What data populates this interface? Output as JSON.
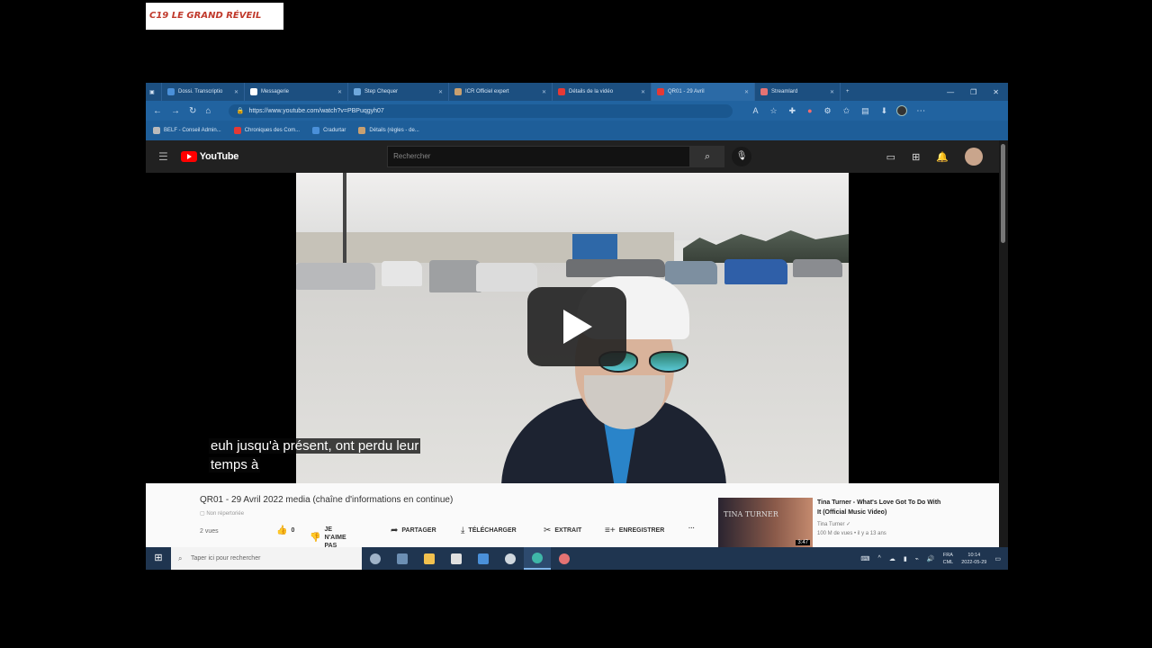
{
  "watermark": "C19 LE GRAND RÉVEIL",
  "browser": {
    "tabs": [
      {
        "label": "Dossi. Transcriptio",
        "color": "#4a90d9",
        "active": false
      },
      {
        "label": "Messagerie",
        "color": "#ffffff",
        "active": false
      },
      {
        "label": "Step Chequer",
        "color": "#6fa8dc",
        "active": false
      },
      {
        "label": "ICR Officiel expert",
        "color": "#c8a070",
        "active": false
      },
      {
        "label": "Détails de la vidéo",
        "color": "#e53935",
        "active": false
      },
      {
        "label": "QR01 - 29 Avril",
        "color": "#e53935",
        "active": true
      },
      {
        "label": "Streamlard",
        "color": "#e57373",
        "active": false
      }
    ],
    "window_controls": [
      "—",
      "❐",
      "✕"
    ],
    "url": "https://www.youtube.com/watch?v=PBPuqgyh07",
    "bookmarks": [
      {
        "label": "BELF - Conseil Admin...",
        "color": "#bbbbbb"
      },
      {
        "label": "Chroniques des Com...",
        "color": "#e53935"
      },
      {
        "label": "Cradurtar",
        "color": "#4a90d9"
      },
      {
        "label": "Détails (règles - de...",
        "color": "#c8a070"
      }
    ]
  },
  "youtube": {
    "logo_text": "YouTube",
    "search_placeholder": "Rechercher",
    "video": {
      "subtitle_line1": "euh jusqu'à présent, ont perdu leur",
      "subtitle_line2": "temps à",
      "title": "QR01 - 29 Avril 2022 media (chaîne d'informations en continue)",
      "channel_badge": "Non répertoriée",
      "views": "2 vues",
      "like_count": "0",
      "dislike_label": "JE N'AIME PAS",
      "share_label": "PARTAGER",
      "download_label": "TÉLÉCHARGER",
      "clip_label": "EXTRAIT",
      "save_label": "ENREGISTRER",
      "more_label": "···"
    },
    "recommendation": {
      "title": "Tina Turner - What's Love Got To Do With It (Official Music Video)",
      "channel": "Tina Turner ✓",
      "meta": "100 M de vues • il y a 13 ans",
      "duration": "3:47",
      "thumb_text": "TINA TURNER"
    }
  },
  "taskbar": {
    "search_placeholder": "Taper ici pour rechercher",
    "apps": [
      {
        "name": "task-view",
        "color": "#9fb3c8",
        "active": false
      },
      {
        "name": "widgets",
        "color": "#6c8fb3",
        "active": false
      },
      {
        "name": "file-explorer",
        "color": "#f2c14e",
        "active": false
      },
      {
        "name": "store",
        "color": "#e0e0e0",
        "active": false
      },
      {
        "name": "mail",
        "color": "#4a90d9",
        "active": false
      },
      {
        "name": "chrome-like",
        "color": "#d0d7de",
        "active": false
      },
      {
        "name": "edge",
        "color": "#3fb6a8",
        "active": true
      },
      {
        "name": "paint",
        "color": "#e57373",
        "active": false
      }
    ],
    "lang_top": "FRA",
    "lang_bottom": "CML",
    "time": "10:14",
    "date": "2022-05-29"
  }
}
